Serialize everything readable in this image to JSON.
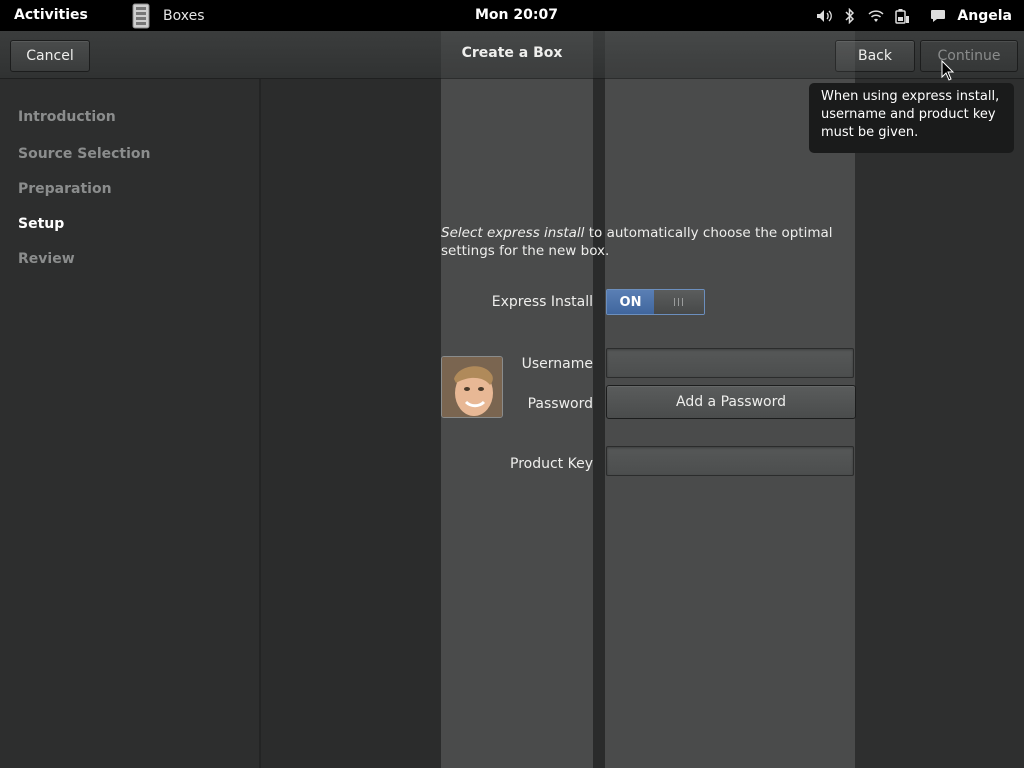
{
  "topbar": {
    "activities": "Activities",
    "app_name": "Boxes",
    "app_icon": "boxes-app-icon",
    "clock": "Mon 20:07",
    "user": "Angela",
    "status_icons": [
      "volume-icon",
      "bluetooth-icon",
      "wifi-icon",
      "battery-icon",
      "chat-icon"
    ]
  },
  "header": {
    "title": "Create a Box",
    "cancel_label": "Cancel",
    "back_label": "Back",
    "continue_label": "Continue"
  },
  "sidebar": {
    "steps": [
      {
        "label": "Introduction",
        "active": false
      },
      {
        "label": "Source Selection",
        "active": false
      },
      {
        "label": "Preparation",
        "active": false
      },
      {
        "label": "Setup",
        "active": true
      },
      {
        "label": "Review",
        "active": false
      }
    ]
  },
  "setup": {
    "description_em": "Select express install",
    "description_rest": " to automatically choose the optimal settings for the new box.",
    "express_label": "Express Install",
    "toggle_on": "ON",
    "username_label": "Username",
    "username_value": "",
    "password_label": "Password",
    "add_password_label": "Add a Password",
    "product_key_label": "Product Key",
    "product_key_value": ""
  },
  "tooltip": {
    "text": "When using express install, username and product key must be given."
  },
  "colors": {
    "accent": "#4a6fa5",
    "background": "#2b2c2c",
    "panel": "#4a4b4b"
  }
}
